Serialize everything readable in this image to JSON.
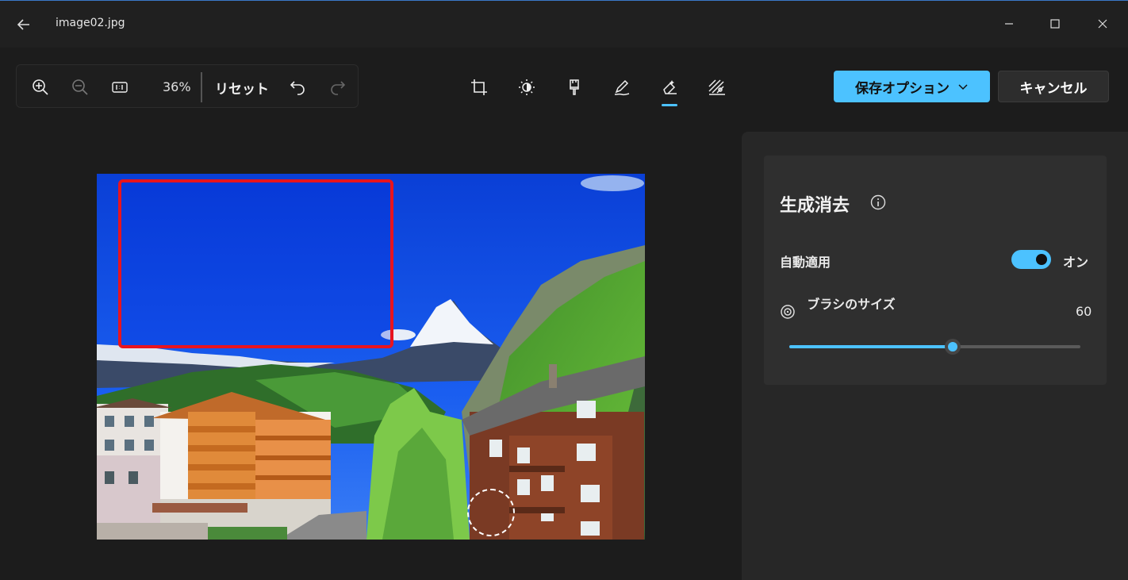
{
  "window": {
    "title": "image02.jpg"
  },
  "toolbar": {
    "zoom_level": "36%",
    "reset_label": "リセット"
  },
  "actions": {
    "save_label": "保存オプション",
    "cancel_label": "キャンセル"
  },
  "panel": {
    "title": "生成消去",
    "auto_apply_label": "自動適用",
    "auto_apply_state": "オン",
    "brush_size_label": "ブラシのサイズ",
    "brush_size_value": "60",
    "brush_size_fraction": 0.56
  },
  "colors": {
    "accent": "#4cc2ff",
    "selection": "#e8141e",
    "background": "#1c1c1c"
  },
  "icons": [
    "back-arrow-icon",
    "minimize-icon",
    "maximize-icon",
    "close-icon",
    "zoom-in-icon",
    "zoom-out-icon",
    "actual-size-icon",
    "undo-icon",
    "redo-icon",
    "crop-icon",
    "brightness-icon",
    "brush-icon",
    "markup-icon",
    "erase-icon",
    "background-icon",
    "chevron-down-icon",
    "info-icon",
    "target-icon"
  ]
}
